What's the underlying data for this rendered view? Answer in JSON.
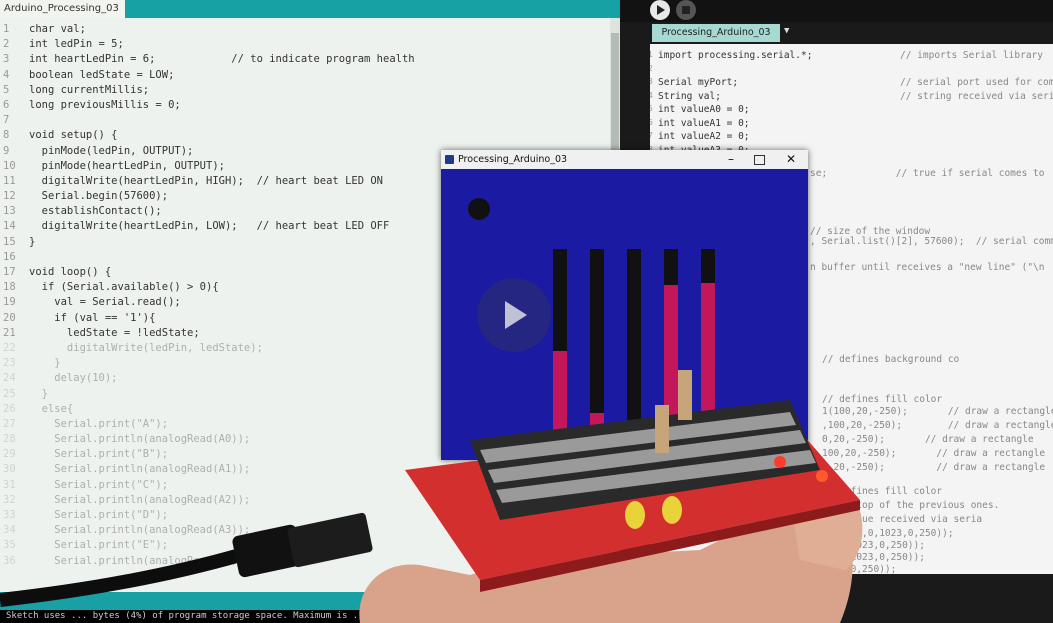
{
  "arduino": {
    "tab_label": "Arduino_Processing_03",
    "console_text": "Sketch uses ... bytes (4%) of program storage space. Maximum is ...",
    "code_lines": [
      {
        "num": "1",
        "text": "char val;"
      },
      {
        "num": "2",
        "text": "int ledPin = 5;"
      },
      {
        "num": "3",
        "text": "int heartLedPin = 6;            // to indicate program health"
      },
      {
        "num": "4",
        "text": "boolean ledState = LOW;"
      },
      {
        "num": "5",
        "text": "long currentMillis;"
      },
      {
        "num": "6",
        "text": "long previousMillis = 0;"
      },
      {
        "num": "7",
        "text": ""
      },
      {
        "num": "8",
        "text": "void setup() {"
      },
      {
        "num": "9",
        "text": "  pinMode(ledPin, OUTPUT);"
      },
      {
        "num": "10",
        "text": "  pinMode(heartLedPin, OUTPUT);"
      },
      {
        "num": "11",
        "text": "  digitalWrite(heartLedPin, HIGH);  // heart beat LED ON"
      },
      {
        "num": "12",
        "text": "  Serial.begin(57600);"
      },
      {
        "num": "13",
        "text": "  establishContact();"
      },
      {
        "num": "14",
        "text": "  digitalWrite(heartLedPin, LOW);   // heart beat LED OFF"
      },
      {
        "num": "15",
        "text": "}"
      },
      {
        "num": "16",
        "text": ""
      },
      {
        "num": "17",
        "text": "void loop() {"
      },
      {
        "num": "18",
        "text": "  if (Serial.available() > 0){"
      },
      {
        "num": "19",
        "text": "    val = Serial.read();"
      },
      {
        "num": "20",
        "text": "    if (val == '1'){"
      },
      {
        "num": "21",
        "text": "      ledState = !ledState;"
      },
      {
        "num": "22",
        "text": "      digitalWrite(ledPin, ledState);"
      },
      {
        "num": "23",
        "text": "    }"
      },
      {
        "num": "24",
        "text": "    delay(10);"
      },
      {
        "num": "25",
        "text": "  }"
      },
      {
        "num": "26",
        "text": "  else{"
      },
      {
        "num": "27",
        "text": "    Serial.print(\"A\");"
      },
      {
        "num": "28",
        "text": "    Serial.println(analogRead(A0));"
      },
      {
        "num": "29",
        "text": "    Serial.print(\"B\");"
      },
      {
        "num": "30",
        "text": "    Serial.println(analogRead(A1));"
      },
      {
        "num": "31",
        "text": "    Serial.print(\"C\");"
      },
      {
        "num": "32",
        "text": "    Serial.println(analogRead(A2));"
      },
      {
        "num": "33",
        "text": "    Serial.print(\"D\");"
      },
      {
        "num": "34",
        "text": "    Serial.println(analogRead(A3));"
      },
      {
        "num": "35",
        "text": "    Serial.print(\"E\");"
      },
      {
        "num": "36",
        "text": "    Serial.println(analogRead(A4));"
      }
    ]
  },
  "processing": {
    "tab_label": "Processing_Arduino_03",
    "code_lines": [
      {
        "num": "1",
        "text": "import processing.serial.*;",
        "comment": "// imports Serial library"
      },
      {
        "num": "2",
        "text": "",
        "comment": ""
      },
      {
        "num": "3",
        "text": "Serial myPort;",
        "comment": "// serial port used for com"
      },
      {
        "num": "4",
        "text": "String val;",
        "comment": "// string received via seri"
      },
      {
        "num": "5",
        "text": "int valueA0 = 0;",
        "comment": ""
      },
      {
        "num": "6",
        "text": "int valueA1 = 0;",
        "comment": ""
      },
      {
        "num": "7",
        "text": "int valueA2 = 0;",
        "comment": ""
      },
      {
        "num": "8",
        "text": "int valueA3 = 0;",
        "comment": ""
      }
    ],
    "right_fragments": [
      "se;            // true if serial comes to",
      "// size of the window",
      ", Serial.list()[2], 57600);  // serial comm",
      "n buffer until receives a \"new line\" (\"\\n",
      "// defines background co",
      "// defines fill color",
      "1(100,20,-250);       // draw a rectangle",
      ",100,20,-250);        // draw a rectangle",
      "0,20,-250);       // draw a rectangle",
      "100,20,-250);       // draw a rectangle",
      "0,20,-250);         // draw a rectangle",
      "// defines fill color",
      "wn on top of the previous ones.",
      "the value received via seria",
      "valueA0,0,1023,0,250));",
      "A1,0,1023,0,250));",
      "A2,0,1023,0,250));",
      "1023,0,250));"
    ]
  },
  "sketch": {
    "window_title": "Processing_Arduino_03",
    "bars": [
      0.49,
      0.18,
      0.0,
      0.82,
      0.83
    ]
  },
  "colors": {
    "sketch_bg": "#1b1aa3",
    "bar_track": "#111111",
    "bar_fill": "#c2185b",
    "arduino_teal": "#17a1a5"
  }
}
